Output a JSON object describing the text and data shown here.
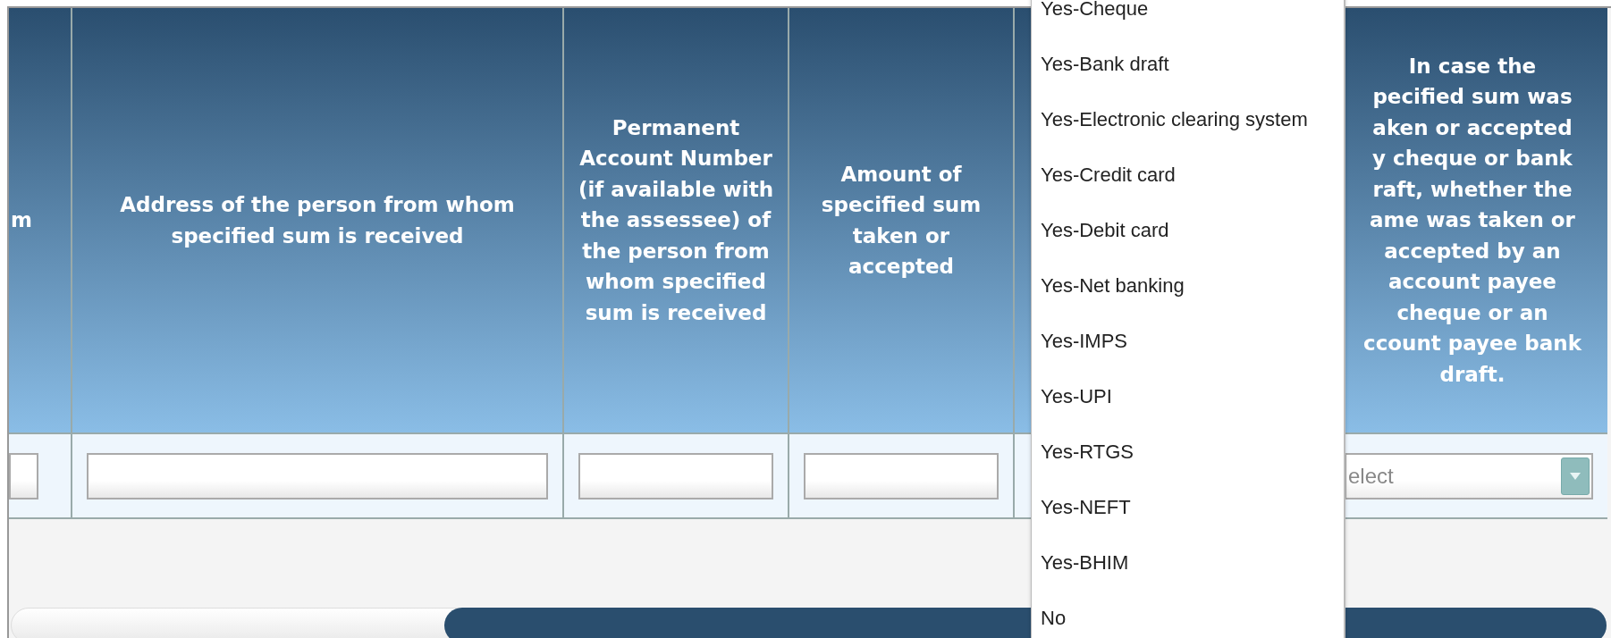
{
  "table": {
    "columns": [
      {
        "heading": "m",
        "cell": {
          "kind": "input"
        }
      },
      {
        "heading": "Address of the person from whom specified sum is received",
        "cell": {
          "kind": "input"
        }
      },
      {
        "heading": "Permanent Account Number (if available with the assessee) of the person from whom specified sum is received",
        "cell": {
          "kind": "input"
        }
      },
      {
        "heading": "Amount of specified sum taken or accepted",
        "cell": {
          "kind": "input"
        }
      },
      {
        "cell": {
          "kind": "hidden"
        }
      },
      {
        "heading_lines": [
          "In case the",
          "pecified sum was",
          "aken or accepted",
          "y cheque or bank",
          "raft, whether the",
          "ame was taken or",
          "accepted by an",
          "account payee",
          "cheque or an",
          "ccount payee bank",
          "draft."
        ],
        "cell": {
          "kind": "select",
          "value": "elect"
        }
      }
    ]
  },
  "dropdown": {
    "options": [
      {
        "label": "Yes-Cheque",
        "selected": false
      },
      {
        "label": "Yes-Bank draft",
        "selected": false
      },
      {
        "label": "Yes-Electronic clearing system",
        "selected": false
      },
      {
        "label": "Yes-Credit card",
        "selected": false
      },
      {
        "label": "Yes-Debit card",
        "selected": false
      },
      {
        "label": "Yes-Net banking",
        "selected": false
      },
      {
        "label": "Yes-IMPS",
        "selected": false
      },
      {
        "label": "Yes-UPI",
        "selected": false
      },
      {
        "label": "Yes-RTGS",
        "selected": false
      },
      {
        "label": "Yes-NEFT",
        "selected": false
      },
      {
        "label": "Yes-BHIM",
        "selected": false
      },
      {
        "label": "No",
        "selected": false
      }
    ]
  }
}
